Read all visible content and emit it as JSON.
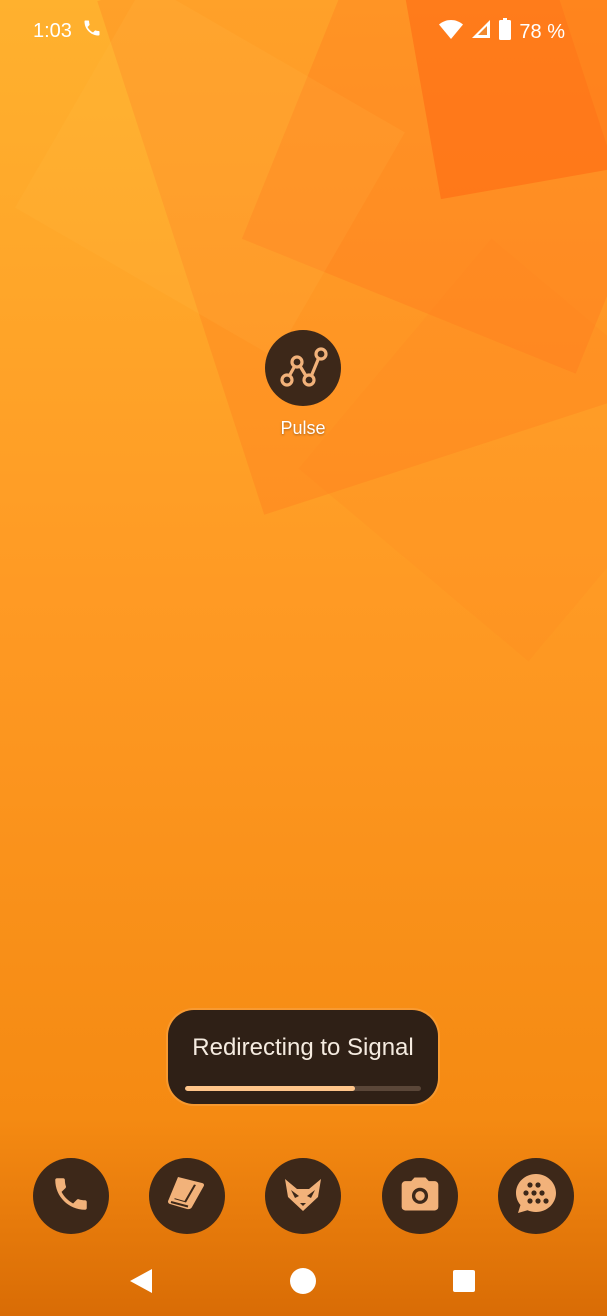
{
  "status_bar": {
    "time": "1:03",
    "battery": "78 %",
    "icons": [
      "phone-call-icon",
      "wifi-icon",
      "cell-signal-icon",
      "battery-icon"
    ]
  },
  "home": {
    "app": {
      "label": "Pulse",
      "icon": "chart-graph-icon"
    }
  },
  "toast": {
    "message": "Redirecting to Signal",
    "progress": 0.72
  },
  "dock": {
    "apps": [
      {
        "icon": "phone-icon"
      },
      {
        "icon": "book-icon"
      },
      {
        "icon": "fox-icon"
      },
      {
        "icon": "camera-icon"
      },
      {
        "icon": "messages-icon"
      }
    ]
  },
  "navigation": {
    "buttons": [
      "back-icon",
      "home-icon",
      "recents-icon"
    ]
  },
  "colors": {
    "icon_background": "#3d2819",
    "icon_foreground": "#f2b27a",
    "toast_background": "#2f2016",
    "toast_progress": "#ffc58a"
  }
}
